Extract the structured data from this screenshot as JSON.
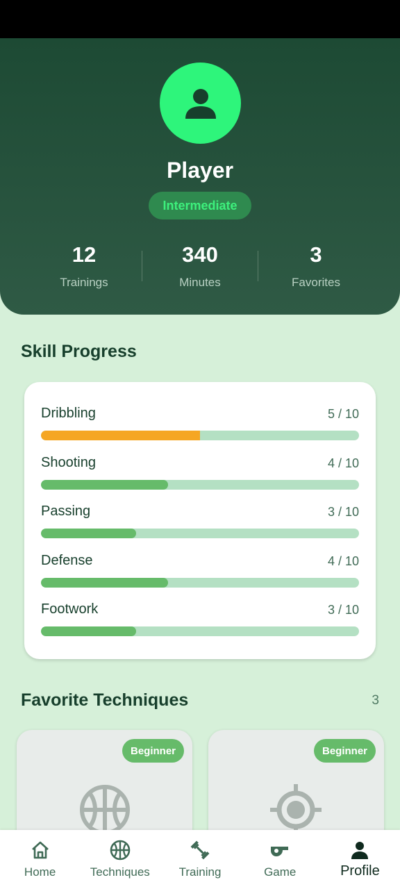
{
  "profile": {
    "name": "Player",
    "level": "Intermediate",
    "stats": [
      {
        "value": "12",
        "label": "Trainings"
      },
      {
        "value": "340",
        "label": "Minutes"
      },
      {
        "value": "3",
        "label": "Favorites"
      }
    ]
  },
  "skills": {
    "title": "Skill Progress",
    "items": [
      {
        "name": "Dribbling",
        "score": "5 / 10",
        "progress": 0.5,
        "highlight": true
      },
      {
        "name": "Shooting",
        "score": "4 / 10",
        "progress": 0.4,
        "highlight": false
      },
      {
        "name": "Passing",
        "score": "3 / 10",
        "progress": 0.3,
        "highlight": false
      },
      {
        "name": "Defense",
        "score": "4 / 10",
        "progress": 0.4,
        "highlight": false
      },
      {
        "name": "Footwork",
        "score": "3 / 10",
        "progress": 0.3,
        "highlight": false
      }
    ]
  },
  "favorites": {
    "title": "Favorite Techniques",
    "count": "3",
    "cards": [
      {
        "badge": "Beginner",
        "icon": "basketball-icon"
      },
      {
        "badge": "Beginner",
        "icon": "target-icon"
      }
    ]
  },
  "nav": {
    "items": [
      {
        "label": "Home",
        "icon": "home-icon"
      },
      {
        "label": "Techniques",
        "icon": "basketball-icon"
      },
      {
        "label": "Training",
        "icon": "dumbbell-icon"
      },
      {
        "label": "Game",
        "icon": "whistle-icon"
      },
      {
        "label": "Profile",
        "icon": "person-icon"
      }
    ],
    "active": "Profile"
  },
  "colors": {
    "header": "#1d4a34",
    "accent": "#2ef57b",
    "progress": "#66bb6a",
    "progress_highlight": "#f5a623",
    "track": "#b4e0c3",
    "background": "#d6f0d9"
  }
}
